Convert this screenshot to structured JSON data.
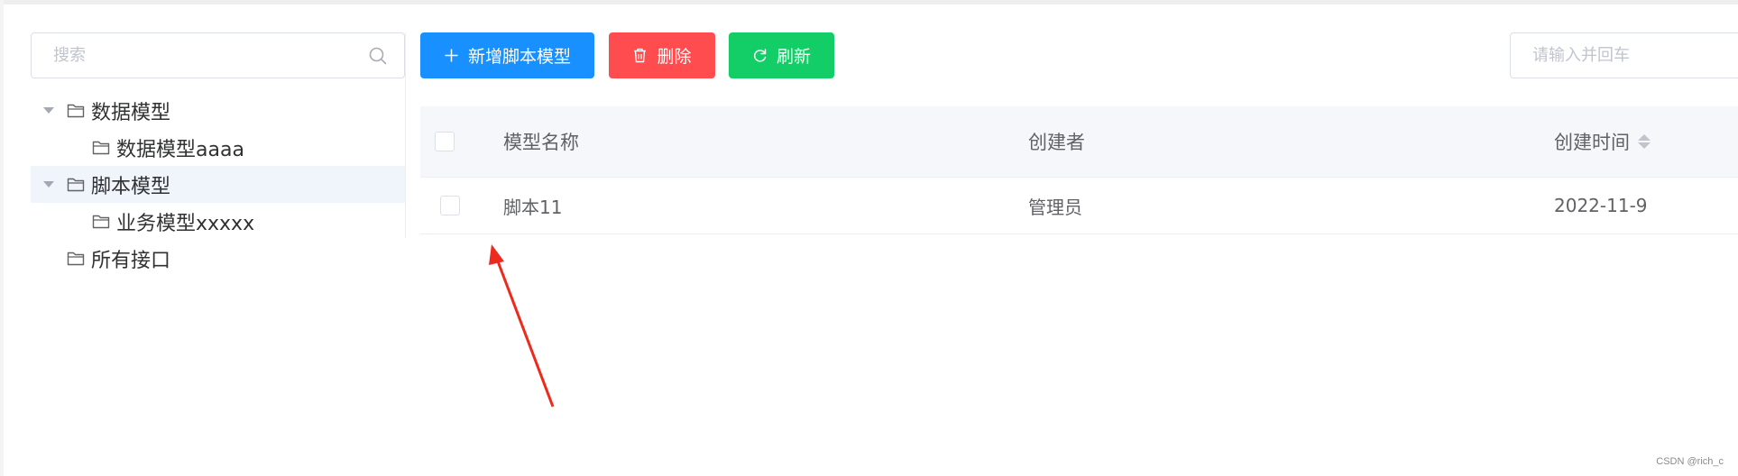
{
  "sidebar": {
    "search": {
      "placeholder": "搜索",
      "value": ""
    },
    "tree": [
      {
        "label": "数据模型",
        "expanded": true,
        "children": [
          {
            "label": "数据模型aaaa"
          }
        ]
      },
      {
        "label": "脚本模型",
        "expanded": true,
        "selected": true,
        "children": [
          {
            "label": "业务模型xxxxx"
          }
        ]
      },
      {
        "label": "所有接口"
      }
    ]
  },
  "toolbar": {
    "add_label": "新增脚本模型",
    "delete_label": "删除",
    "refresh_label": "刷新",
    "search": {
      "placeholder": "请输入并回车",
      "value": ""
    }
  },
  "table": {
    "columns": [
      "模型名称",
      "创建者",
      "创建时间"
    ],
    "sortable_column": "创建时间",
    "rows": [
      {
        "name": "脚本11",
        "creator": "管理员",
        "created": "2022-11-9",
        "checked": false
      }
    ]
  },
  "watermark": "CSDN @rich_c",
  "colors": {
    "primary": "#1890ff",
    "danger": "#ff4d4f",
    "success": "#13ce66",
    "selected_bg": "#f0f5fc",
    "annotation_arrow": "#ee2a1e"
  },
  "icons": {
    "search": "search-icon",
    "folder": "folder-icon",
    "add": "plus-icon",
    "delete": "trash-icon",
    "refresh": "refresh-icon",
    "sort": "sort-caret-icon",
    "expand": "caret-down-icon"
  }
}
